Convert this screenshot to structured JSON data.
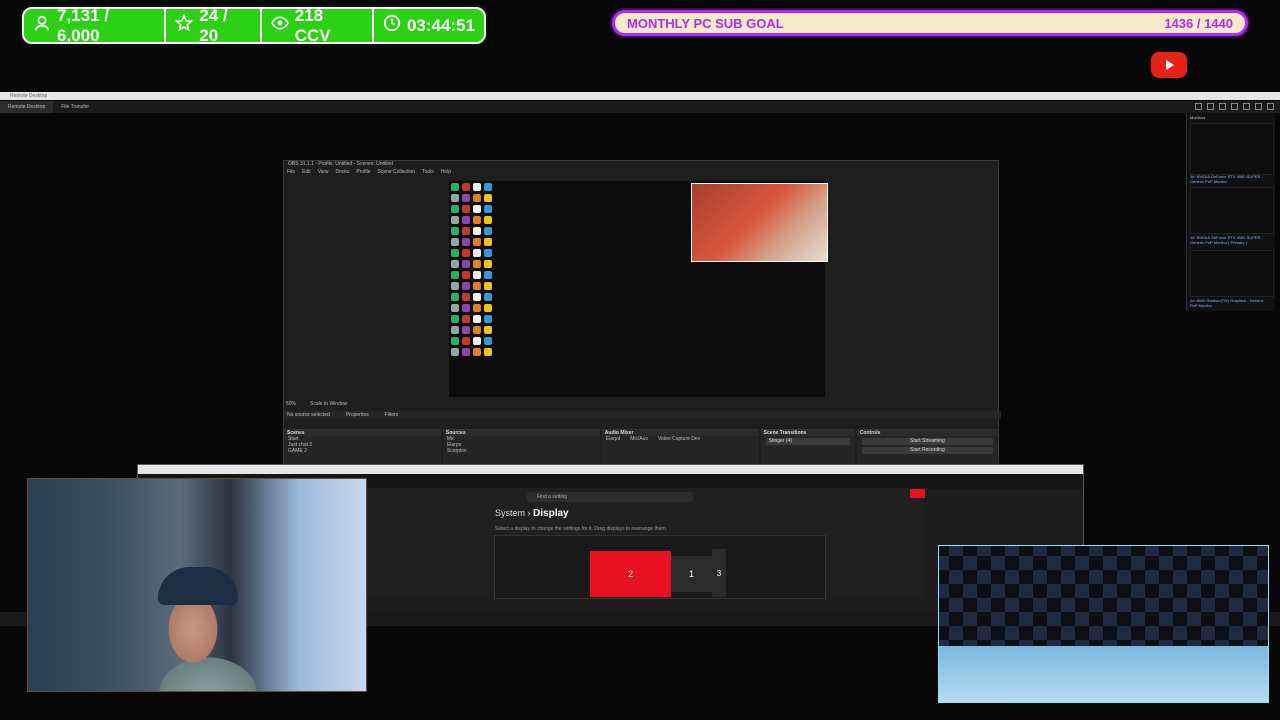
{
  "stats": {
    "followers": "7,131 / 6,000",
    "subs": "24 / 20",
    "ccv": "218 CCV",
    "timer": "03:44:51"
  },
  "goal": {
    "label": "MONTHLY PC SUB GOAL",
    "value": "1436 / 1440",
    "progress": 0.997
  },
  "remote": {
    "title": "Remote Desktop",
    "tabs": [
      "Remote Desktop",
      "File Transfer"
    ]
  },
  "obs": {
    "title": "OBS 31.1.1 - Profile: Untitled - Scenes: Untitled",
    "menu": [
      "File",
      "Edit",
      "View",
      "Docks",
      "Profile",
      "Scene Collection",
      "Tools",
      "Help"
    ],
    "no_source": "No source selected",
    "properties": "Properties",
    "filters": "Filters",
    "zoom": "50%",
    "scale": "Scale to Window",
    "docks": {
      "scenes": {
        "title": "Scenes",
        "items": [
          "Start",
          "Just chat 2",
          "GAME 2"
        ]
      },
      "sources": {
        "title": "Sources",
        "items": [
          "Mic",
          "Elarps",
          "Scorpion"
        ]
      },
      "mixer": {
        "title": "Audio Mixer",
        "channels": [
          "Elarpd",
          "Mic/Aux",
          "Video Capture Dev"
        ]
      },
      "transitions": {
        "title": "Scene Transitions",
        "value": "Stinger (4)"
      },
      "controls": {
        "title": "Controls",
        "buttons": [
          "Start Streaming",
          "Start Recording"
        ]
      }
    }
  },
  "settings": {
    "search_placeholder": "Find a setting",
    "breadcrumb_parent": "System",
    "breadcrumb_sep": "›",
    "breadcrumb_current": "Display",
    "hint": "Select a display to change the settings for it. Drag displays to rearrange them.",
    "monitors": [
      "2",
      "1",
      "3"
    ]
  },
  "monitors_panel": {
    "title": "Monitors",
    "items": [
      "1#: NVIDIA GeForce RTX 4080 SUPER - Generic PnP Monitor",
      "1#: NVIDIA GeForce RTX 4080 SUPER - Generic PnP Monitor ( Primary )",
      "2#: AMD Radeon(TM) Graphics - Generic PnP Monitor"
    ]
  },
  "colors": {
    "stats_bg": "#2cd116",
    "goal_border": "#b22cf0",
    "goal_bg": "#f3ebc9",
    "windows_red": "#e81123",
    "youtube": "#e62117"
  },
  "icons": [
    "follower-icon",
    "star-icon",
    "eye-icon",
    "clock-icon",
    "youtube-icon"
  ]
}
